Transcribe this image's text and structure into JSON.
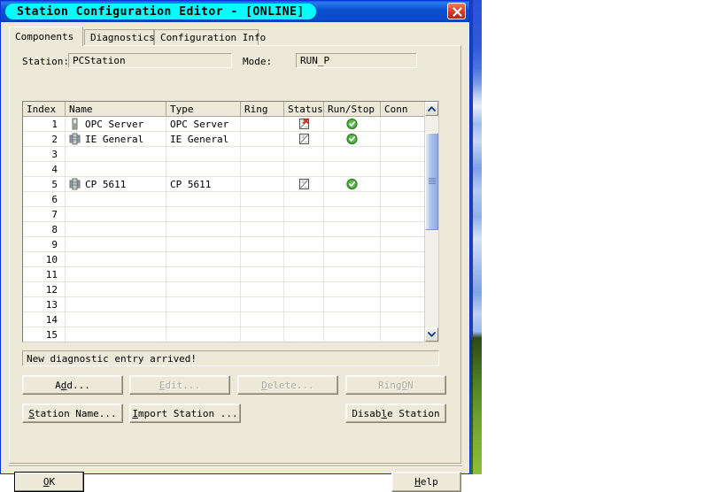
{
  "window": {
    "title": "Station Configuration Editor - [ONLINE]",
    "close_icon": "close-icon",
    "accent_titlebar": "#0a50d0",
    "accent_title_highlight": "#00ffff",
    "accent_close": "#d93a22"
  },
  "tabs": [
    {
      "label": "Components",
      "active": true
    },
    {
      "label": "Diagnostics",
      "active": false
    },
    {
      "label": "Configuration Info",
      "active": false
    }
  ],
  "fields": {
    "station_label": "Station:",
    "station_value": "PCStation",
    "mode_label": "Mode:",
    "mode_value": "RUN_P"
  },
  "grid": {
    "columns": [
      "Index",
      "Name",
      "Type",
      "Ring",
      "Status",
      "Run/Stop",
      "Conn"
    ],
    "rows": [
      {
        "index": "1",
        "icon": "module-opc-icon",
        "name": "OPC Server",
        "type": "OPC Server",
        "ring": "",
        "status": "status-error-icon",
        "runstop": "run-ok-icon",
        "conn": ""
      },
      {
        "index": "2",
        "icon": "module-card-icon",
        "name": "IE General",
        "type": "IE General",
        "ring": "",
        "status": "status-config-icon",
        "runstop": "run-ok-icon",
        "conn": ""
      },
      {
        "index": "3",
        "icon": "",
        "name": "",
        "type": "",
        "ring": "",
        "status": "",
        "runstop": "",
        "conn": ""
      },
      {
        "index": "4",
        "icon": "",
        "name": "",
        "type": "",
        "ring": "",
        "status": "",
        "runstop": "",
        "conn": ""
      },
      {
        "index": "5",
        "icon": "module-card-icon",
        "name": "CP 5611",
        "type": "CP 5611",
        "ring": "",
        "status": "status-config-icon",
        "runstop": "run-ok-icon",
        "conn": ""
      },
      {
        "index": "6",
        "icon": "",
        "name": "",
        "type": "",
        "ring": "",
        "status": "",
        "runstop": "",
        "conn": ""
      },
      {
        "index": "7",
        "icon": "",
        "name": "",
        "type": "",
        "ring": "",
        "status": "",
        "runstop": "",
        "conn": ""
      },
      {
        "index": "8",
        "icon": "",
        "name": "",
        "type": "",
        "ring": "",
        "status": "",
        "runstop": "",
        "conn": ""
      },
      {
        "index": "9",
        "icon": "",
        "name": "",
        "type": "",
        "ring": "",
        "status": "",
        "runstop": "",
        "conn": ""
      },
      {
        "index": "10",
        "icon": "",
        "name": "",
        "type": "",
        "ring": "",
        "status": "",
        "runstop": "",
        "conn": ""
      },
      {
        "index": "11",
        "icon": "",
        "name": "",
        "type": "",
        "ring": "",
        "status": "",
        "runstop": "",
        "conn": ""
      },
      {
        "index": "12",
        "icon": "",
        "name": "",
        "type": "",
        "ring": "",
        "status": "",
        "runstop": "",
        "conn": ""
      },
      {
        "index": "13",
        "icon": "",
        "name": "",
        "type": "",
        "ring": "",
        "status": "",
        "runstop": "",
        "conn": ""
      },
      {
        "index": "14",
        "icon": "",
        "name": "",
        "type": "",
        "ring": "",
        "status": "",
        "runstop": "",
        "conn": ""
      },
      {
        "index": "15",
        "icon": "",
        "name": "",
        "type": "",
        "ring": "",
        "status": "",
        "runstop": "",
        "conn": ""
      }
    ],
    "scrollbar": {
      "up_icon": "chevron-up-icon",
      "down_icon": "chevron-down-icon",
      "thumb_position_percent": 8
    }
  },
  "status_message": "New diagnostic entry arrived!",
  "buttons": {
    "add": {
      "label": "Add...",
      "disabled": false
    },
    "edit": {
      "label": "Edit...",
      "disabled": true
    },
    "delete": {
      "label": "Delete...",
      "disabled": true
    },
    "ring_on": {
      "label": "Ring ON",
      "disabled": true
    },
    "station_name": {
      "label": "Station Name...",
      "disabled": false
    },
    "import_station": {
      "label": "Import Station ...",
      "disabled": false
    },
    "disable_station": {
      "label": "Disable Station",
      "disabled": false
    },
    "ok": {
      "label": "OK",
      "disabled": false
    },
    "help": {
      "label": "Help",
      "disabled": false
    }
  }
}
